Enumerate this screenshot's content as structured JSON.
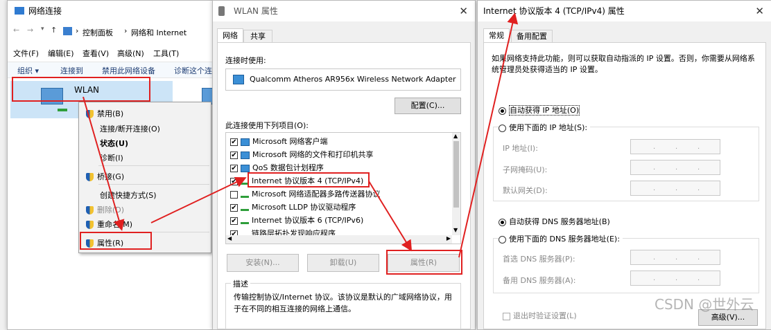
{
  "net_window": {
    "title": "网络连接",
    "breadcrumb": [
      "控制面板",
      "网络和 Internet"
    ],
    "menu": [
      "文件(F)",
      "编辑(E)",
      "查看(V)",
      "高级(N)",
      "工具(T)"
    ],
    "toolbar": [
      "组织 ▾",
      "连接到",
      "禁用此网络设备",
      "诊断这个连"
    ],
    "wlan_label": "WLAN",
    "context_menu": [
      "禁用(B)",
      "连接/断开连接(O)",
      "状态(U)",
      "诊断(I)",
      "桥接(G)",
      "创建快捷方式(S)",
      "删除(D)",
      "重命名(M)",
      "属性(R)"
    ]
  },
  "wlan_props": {
    "title": "WLAN 属性",
    "tabs": [
      "网络",
      "共享"
    ],
    "connect_using_label": "连接时使用:",
    "adapter": "Qualcomm Atheros AR956x Wireless Network Adapter",
    "configure_button": "配置(C)...",
    "items_label": "此连接使用下列项目(O):",
    "items": [
      {
        "label": "Microsoft 网络客户端",
        "checked": true
      },
      {
        "label": "Microsoft 网络的文件和打印机共享",
        "checked": true
      },
      {
        "label": "QoS 数据包计划程序",
        "checked": true
      },
      {
        "label": "Internet 协议版本 4 (TCP/IPv4)",
        "checked": true
      },
      {
        "label": "Microsoft 网络适配器多路传送器协议",
        "checked": false
      },
      {
        "label": "Microsoft LLDP 协议驱动程序",
        "checked": true
      },
      {
        "label": "Internet 协议版本 6 (TCP/IPv6)",
        "checked": true
      },
      {
        "label": "链路层拓扑发现响应程序",
        "checked": true
      }
    ],
    "install_button": "安装(N)...",
    "uninstall_button": "卸载(U)",
    "properties_button": "属性(R)",
    "description_label": "描述",
    "description": "传输控制协议/Internet 协议。该协议是默认的广域网络协议，用于在不同的相互连接的网络上通信。"
  },
  "ipv4_props": {
    "title": "Internet 协议版本 4 (TCP/IPv4) 属性",
    "tabs": [
      "常规",
      "备用配置"
    ],
    "intro": "如果网络支持此功能，则可以获取自动指派的 IP 设置。否则，你需要从网络系统管理员处获得适当的 IP 设置。",
    "auto_ip": "自动获得 IP 地址(O)",
    "manual_ip": "使用下面的 IP 地址(S):",
    "ip_label": "IP 地址(I):",
    "mask_label": "子网掩码(U):",
    "gateway_label": "默认网关(D):",
    "auto_dns": "自动获得 DNS 服务器地址(B)",
    "manual_dns": "使用下面的 DNS 服务器地址(E):",
    "pref_dns_label": "首选 DNS 服务器(P):",
    "alt_dns_label": "备用 DNS 服务器(A):",
    "validate": "退出时验证设置(L)",
    "advanced_button": "高级(V)..."
  },
  "watermark": "CSDN @世外云"
}
